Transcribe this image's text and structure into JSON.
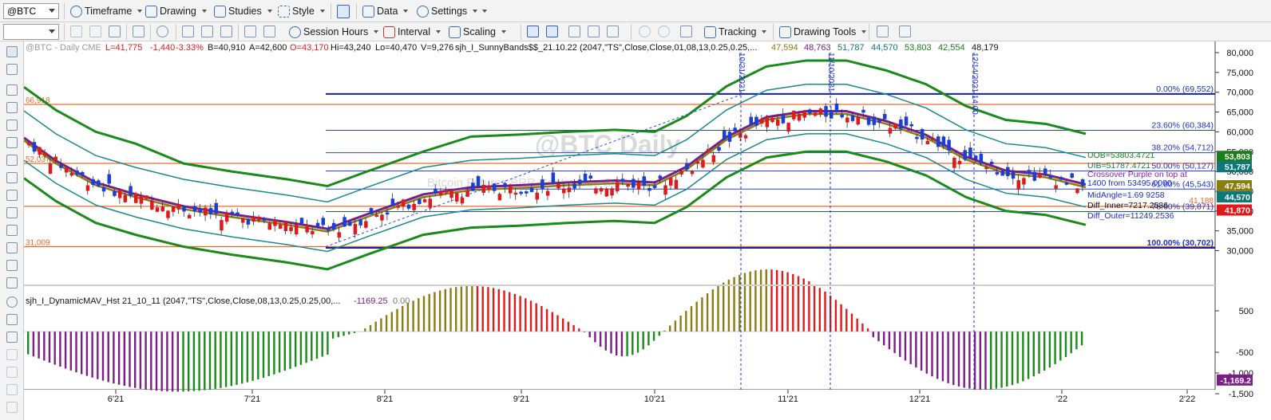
{
  "toolbar1": {
    "symbol": "@BTC",
    "timeframe": "Timeframe",
    "drawing": "Drawing",
    "studies": "Studies",
    "style": "Style",
    "data": "Data",
    "settings": "Settings"
  },
  "toolbar2": {
    "session_hours": "Session Hours",
    "interval": "Interval",
    "scaling": "Scaling",
    "tracking": "Tracking",
    "drawing_tools": "Drawing Tools"
  },
  "price_header": {
    "symbol_line": "@BTC - Daily  CME",
    "last": "L=41,775",
    "chg": "-1,440",
    "pct": "-3.33%",
    "bid": "B=40,910",
    "ask": "A=42,600",
    "open": "O=43,170",
    "high": "Hi=43,240",
    "low": "Lo=40,470",
    "vol": "V=9,276",
    "study": "sjh_I_SunnyBands$$_21.10.22 (2047,\"TS\",Close,Close,01,08,13,0.25,0.25,...",
    "v1": "47,594",
    "v2": "48,763",
    "v3": "51,787",
    "v4": "44,570",
    "v5": "53,803",
    "v6": "42,554",
    "v7": "48,179"
  },
  "lower_header": {
    "study": "sjh_I_DynamicMAV_Hst 21_10_11 (2047,\"TS\",Close,Close,08,13,0.25,0.25,00,...",
    "v1": "-1169.25",
    "v2": "0.00"
  },
  "watermark": {
    "symbol": "@BTC Daily",
    "desc": "Bitcoin Futures BRR Continuous Contract..."
  },
  "price_axis": [
    "80,000",
    "75,000",
    "70,000",
    "65,000",
    "60,000",
    "55,000",
    "50,000",
    "45,000",
    "40,000",
    "35,000",
    "30,000"
  ],
  "price_tags": [
    {
      "text": "53,803",
      "color": "#1a7d1a"
    },
    {
      "text": "51,787",
      "color": "#0f7777"
    },
    {
      "text": "47,594",
      "color": "#8a7d12"
    },
    {
      "text": "44,570",
      "color": "#0f7777"
    },
    {
      "text": "41,870",
      "color": "#e01a1a"
    }
  ],
  "lower_axis": [
    "500",
    "-500",
    "-1,000",
    "-1,500"
  ],
  "lower_tag": {
    "text": "-1,169.2",
    "color": "#7a1f86"
  },
  "time_axis": [
    "6'21",
    "7'21",
    "8'21",
    "9'21",
    "10'21",
    "11'21",
    "12'21",
    "'22",
    "2'22"
  ],
  "vlines": [
    "10/21/2021",
    "11/10/2021",
    "12/14/2021 14:00"
  ],
  "fib_levels": [
    "0.00% (69,552)",
    "23.60% (60,384)",
    "38.20% (54,712)",
    "50.00% (50,127)",
    "61.80% (45,543)",
    "78.60% (39,871)",
    "100.00% (30,702)"
  ],
  "hlines": [
    "66,918",
    "52,037",
    "31,009",
    "41,188"
  ],
  "annotations": [
    "UOB=53803.4721",
    "UIB=51787.4721",
    "Crossover Purple on top at",
    "1400 from 53495.0000",
    "MidAngle=1.69 9258",
    "Diff_Inner=7217.2536",
    "Diff_Outer=11249.2536"
  ]
}
